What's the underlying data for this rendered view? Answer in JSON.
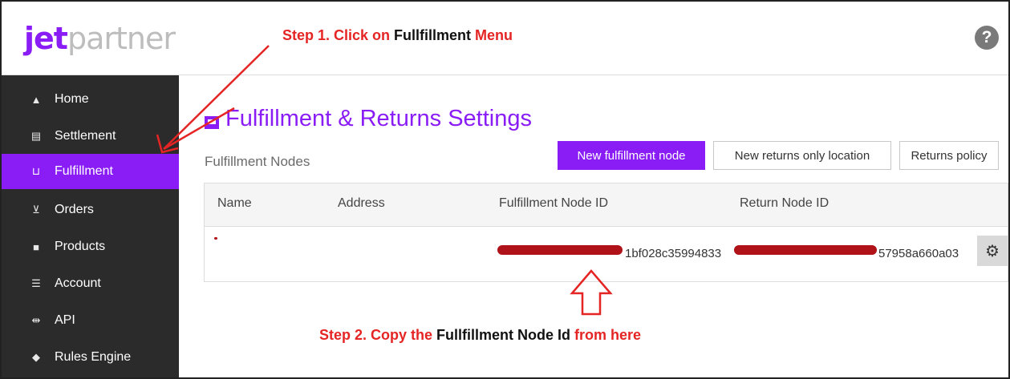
{
  "logo": {
    "jet": "jet",
    "partner": "partner"
  },
  "header": {
    "help": "?"
  },
  "annotations": {
    "step1": {
      "prefix": "Step 1. Click on ",
      "target": "Fullfillment",
      "suffix": " Menu"
    },
    "step2": {
      "prefix": "Step 2. Copy the ",
      "target": "Fullfillment Node Id",
      "suffix": " from here"
    }
  },
  "sidebar": {
    "items": [
      {
        "label": "Home",
        "icon": "home-icon",
        "glyph": "▲"
      },
      {
        "label": "Settlement",
        "icon": "ledger-icon",
        "glyph": "▤"
      },
      {
        "label": "Fulfillment",
        "icon": "cart-icon",
        "glyph": "⊔",
        "active": true
      },
      {
        "label": "Orders",
        "icon": "inbox-icon",
        "glyph": "⊻"
      },
      {
        "label": "Products",
        "icon": "box-icon",
        "glyph": "■"
      },
      {
        "label": "Account",
        "icon": "sliders-icon",
        "glyph": "☰"
      },
      {
        "label": "API",
        "icon": "plug-icon",
        "glyph": "⇹"
      },
      {
        "label": "Rules Engine",
        "icon": "tag-icon",
        "glyph": "◆"
      }
    ]
  },
  "main": {
    "title": "Fulfillment & Returns Settings",
    "section_label": "Fulfillment Nodes",
    "buttons": {
      "new_node": "New fulfillment node",
      "new_returns": "New returns only location",
      "returns_policy": "Returns policy"
    },
    "table": {
      "columns": [
        "Name",
        "Address",
        "Fulfillment Node ID",
        "Return Node ID"
      ],
      "rows": [
        {
          "name": "",
          "address": "",
          "fulfillment_node_id_visible": "1bf028c35994833",
          "return_node_id_visible": "57958a660a03"
        }
      ]
    }
  },
  "colors": {
    "accent": "#8a1cf5",
    "sidebar": "#2b2b2b",
    "annotation": "#e52424"
  }
}
